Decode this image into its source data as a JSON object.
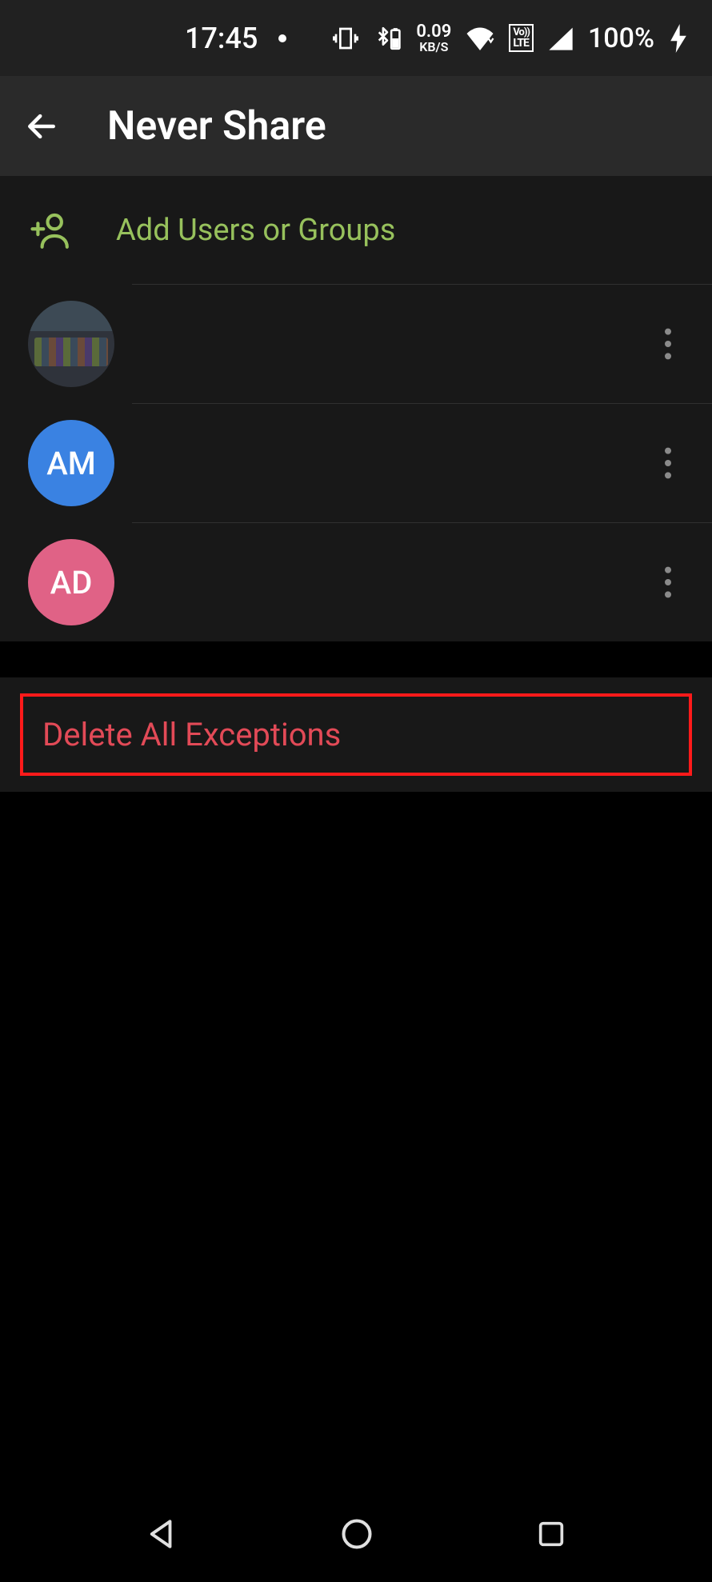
{
  "status": {
    "time": "17:45",
    "net_speed_top": "0.09",
    "net_speed_bottom": "KB/S",
    "volte_l1": "Vo))",
    "volte_l2": "LTE",
    "battery": "100%"
  },
  "header": {
    "title": "Never Share"
  },
  "add_row": {
    "label": "Add Users or Groups"
  },
  "users": [
    {
      "initials": "",
      "name": "",
      "avatar_type": "img",
      "avatar_color": ""
    },
    {
      "initials": "AM",
      "name": "",
      "avatar_type": "letter",
      "avatar_color": "blue"
    },
    {
      "initials": "AD",
      "name": "",
      "avatar_type": "letter",
      "avatar_color": "pink"
    }
  ],
  "delete": {
    "label": "Delete All Exceptions"
  },
  "colors": {
    "accent_green": "#97c15c",
    "danger_red": "#e24a57",
    "highlight_border": "#ff1a1a"
  }
}
